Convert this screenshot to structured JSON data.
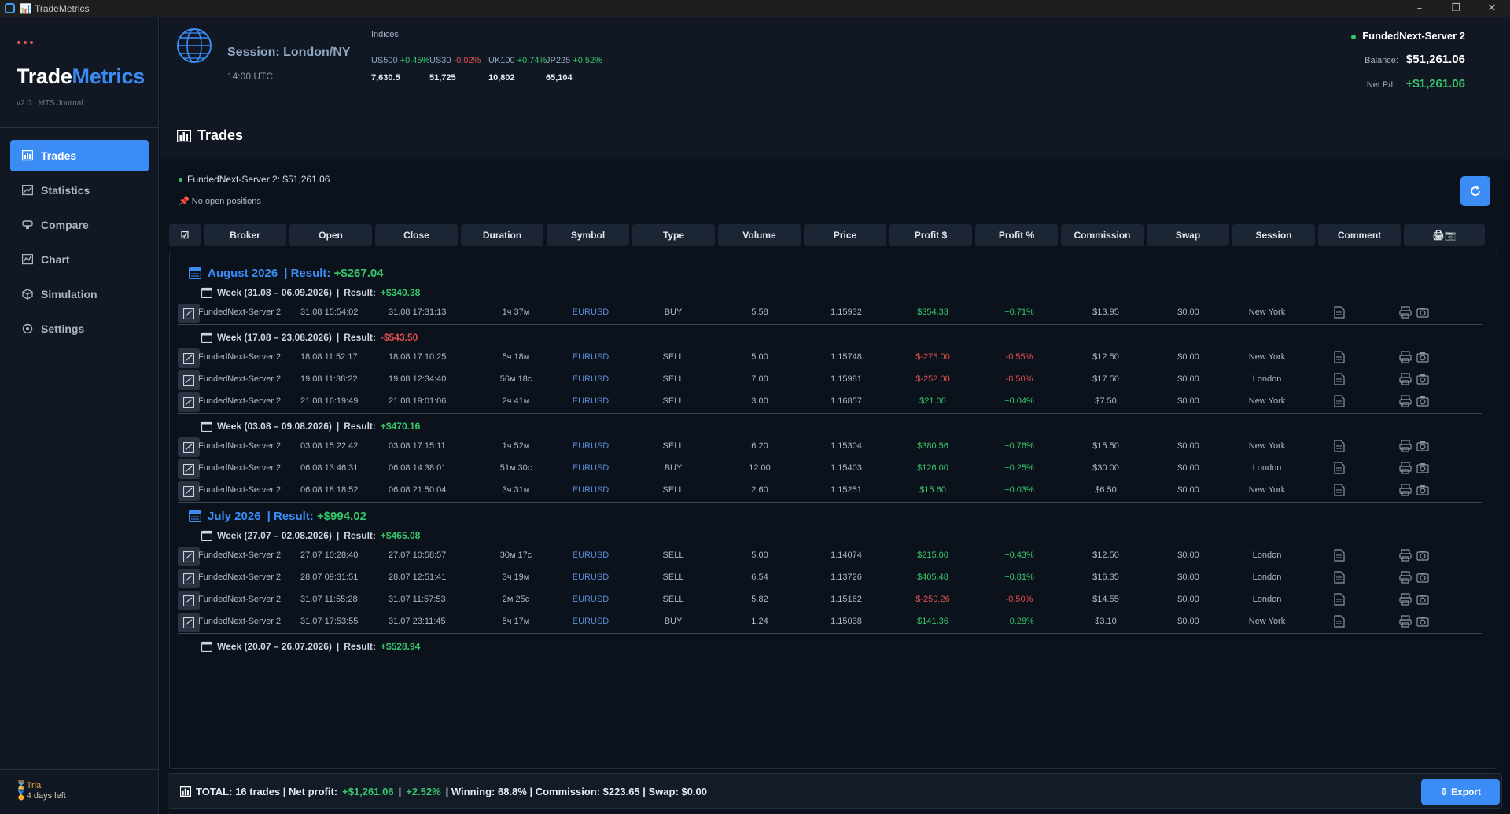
{
  "window": {
    "title": "TradeMetrics",
    "title_glyph": "📊",
    "controls": {
      "minimize": "–",
      "restore": "❐",
      "close": "✕"
    }
  },
  "sidebar": {
    "logo_a": "Trade",
    "logo_b": "Metrics",
    "version": "v2.0 · MTS Journal",
    "items": [
      {
        "label": "Trades",
        "icon": "bar-chart-icon",
        "active": true
      },
      {
        "label": "Statistics",
        "icon": "statistics-icon"
      },
      {
        "label": "Compare",
        "icon": "compare-icon"
      },
      {
        "label": "Chart",
        "icon": "line-chart-icon"
      },
      {
        "label": "Simulation",
        "icon": "cube-icon"
      },
      {
        "label": "Settings",
        "icon": "gear-icon"
      }
    ],
    "trial": "Trial",
    "trial_sub": "4 days left"
  },
  "header": {
    "session_title": "Session: London/NY",
    "session_time": "14:00 UTC",
    "indices_label": "Indices",
    "indices": [
      {
        "name": "US500",
        "change": "+0.45%",
        "value": "7,630.5",
        "dir": "up"
      },
      {
        "name": "US30",
        "change": "-0.02%",
        "value": "51,725",
        "dir": "down"
      },
      {
        "name": "UK100",
        "change": "+0.74%",
        "value": "10,802",
        "dir": "up"
      },
      {
        "name": "JP225",
        "change": "+0.52%",
        "value": "65,104",
        "dir": "up"
      }
    ],
    "account": "FundedNext-Server 2",
    "balance_label": "Balance:",
    "balance": "$51,261.06",
    "pnl_label": "Net P/L:",
    "pnl": "+$1,261.06"
  },
  "page_title": "Trades",
  "server_line": "FundedNext-Server 2: $51,261.06",
  "no_positions": "No open positions",
  "columns": [
    "Broker",
    "Open",
    "Close",
    "Duration",
    "Symbol",
    "Type",
    "Volume",
    "Price",
    "Profit $",
    "Profit %",
    "Commission",
    "Swap",
    "Session",
    "Comment"
  ],
  "header_check": "☑",
  "header_actions": "🖨📷",
  "months": [
    {
      "label": "August 2026",
      "result_label": "Result:",
      "result": "+$267.04",
      "weeks": [
        {
          "label": "Week (31.08 – 06.09.2026)",
          "result": "+$340.38",
          "neg": false,
          "trades": [
            {
              "broker": "FundedNext-Server 2",
              "open": "31.08 15:54:02",
              "close": "31.08 17:31:13",
              "duration": "1ч 37м",
              "symbol": "EURUSD",
              "type": "BUY",
              "volume": "5.58",
              "price": "1.15932",
              "profit": "$354.33",
              "pct": "+0.71%",
              "commission": "$13.95",
              "swap": "$0.00",
              "session": "New York"
            }
          ]
        },
        {
          "label": "Week (17.08 – 23.08.2026)",
          "result": "-$543.50",
          "neg": true,
          "trades": [
            {
              "broker": "FundedNext-Server 2",
              "open": "18.08 11:52:17",
              "close": "18.08 17:10:25",
              "duration": "5ч 18м",
              "symbol": "EURUSD",
              "type": "SELL",
              "volume": "5.00",
              "price": "1.15748",
              "profit": "$-275.00",
              "pct": "-0.55%",
              "commission": "$12.50",
              "swap": "$0.00",
              "session": "New York"
            },
            {
              "broker": "FundedNext-Server 2",
              "open": "19.08 11:38:22",
              "close": "19.08 12:34:40",
              "duration": "56м 18с",
              "symbol": "EURUSD",
              "type": "SELL",
              "volume": "7.00",
              "price": "1.15981",
              "profit": "$-252.00",
              "pct": "-0.50%",
              "commission": "$17.50",
              "swap": "$0.00",
              "session": "London"
            },
            {
              "broker": "FundedNext-Server 2",
              "open": "21.08 16:19:49",
              "close": "21.08 19:01:06",
              "duration": "2ч 41м",
              "symbol": "EURUSD",
              "type": "SELL",
              "volume": "3.00",
              "price": "1.16857",
              "profit": "$21.00",
              "pct": "+0.04%",
              "commission": "$7.50",
              "swap": "$0.00",
              "session": "New York"
            }
          ]
        },
        {
          "label": "Week (03.08 – 09.08.2026)",
          "result": "+$470.16",
          "neg": false,
          "trades": [
            {
              "broker": "FundedNext-Server 2",
              "open": "03.08 15:22:42",
              "close": "03.08 17:15:11",
              "duration": "1ч 52м",
              "symbol": "EURUSD",
              "type": "SELL",
              "volume": "6.20",
              "price": "1.15304",
              "profit": "$380.56",
              "pct": "+0.76%",
              "commission": "$15.50",
              "swap": "$0.00",
              "session": "New York"
            },
            {
              "broker": "FundedNext-Server 2",
              "open": "06.08 13:46:31",
              "close": "06.08 14:38:01",
              "duration": "51м 30с",
              "symbol": "EURUSD",
              "type": "BUY",
              "volume": "12.00",
              "price": "1.15403",
              "profit": "$126.00",
              "pct": "+0.25%",
              "commission": "$30.00",
              "swap": "$0.00",
              "session": "London"
            },
            {
              "broker": "FundedNext-Server 2",
              "open": "06.08 18:18:52",
              "close": "06.08 21:50:04",
              "duration": "3ч 31м",
              "symbol": "EURUSD",
              "type": "SELL",
              "volume": "2.60",
              "price": "1.15251",
              "profit": "$15.60",
              "pct": "+0.03%",
              "commission": "$6.50",
              "swap": "$0.00",
              "session": "New York"
            }
          ]
        }
      ]
    },
    {
      "label": "July 2026",
      "result_label": "Result:",
      "result": "+$994.02",
      "weeks": [
        {
          "label": "Week (27.07 – 02.08.2026)",
          "result": "+$465.08",
          "neg": false,
          "trades": [
            {
              "broker": "FundedNext-Server 2",
              "open": "27.07 10:28:40",
              "close": "27.07 10:58:57",
              "duration": "30м 17с",
              "symbol": "EURUSD",
              "type": "SELL",
              "volume": "5.00",
              "price": "1.14074",
              "profit": "$215.00",
              "pct": "+0.43%",
              "commission": "$12.50",
              "swap": "$0.00",
              "session": "London"
            },
            {
              "broker": "FundedNext-Server 2",
              "open": "28.07 09:31:51",
              "close": "28.07 12:51:41",
              "duration": "3ч 19м",
              "symbol": "EURUSD",
              "type": "SELL",
              "volume": "6.54",
              "price": "1.13726",
              "profit": "$405.48",
              "pct": "+0.81%",
              "commission": "$16.35",
              "swap": "$0.00",
              "session": "London"
            },
            {
              "broker": "FundedNext-Server 2",
              "open": "31.07 11:55:28",
              "close": "31.07 11:57:53",
              "duration": "2м 25с",
              "symbol": "EURUSD",
              "type": "SELL",
              "volume": "5.82",
              "price": "1.15162",
              "profit": "$-250.26",
              "pct": "-0.50%",
              "commission": "$14.55",
              "swap": "$0.00",
              "session": "London"
            },
            {
              "broker": "FundedNext-Server 2",
              "open": "31.07 17:53:55",
              "close": "31.07 23:11:45",
              "duration": "5ч 17м",
              "symbol": "EURUSD",
              "type": "BUY",
              "volume": "1.24",
              "price": "1.15038",
              "profit": "$141.36",
              "pct": "+0.28%",
              "commission": "$3.10",
              "swap": "$0.00",
              "session": "New York"
            }
          ]
        },
        {
          "label": "Week (20.07 – 26.07.2026)",
          "result": "+$528.94",
          "neg": false,
          "trades": []
        }
      ]
    }
  ],
  "week_result_label": "Result:",
  "footer": {
    "prefix": "TOTAL: 16 trades | Net profit:",
    "net": "+$1,261.06",
    "sep": "|",
    "pct": "+2.52%",
    "rest": "| Winning: 68.8% | Commission: $223.65 | Swap: $0.00",
    "export": "Export"
  }
}
